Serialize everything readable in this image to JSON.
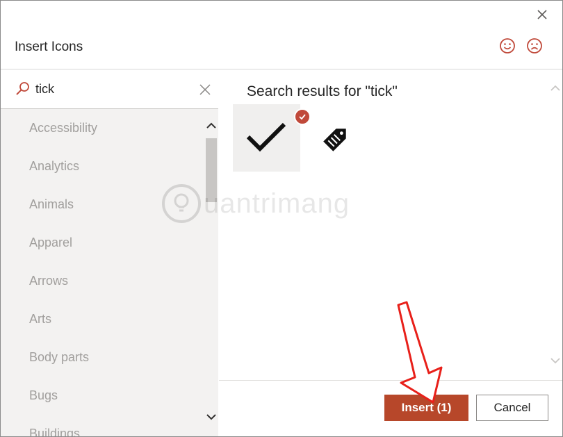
{
  "dialog": {
    "title": "Insert Icons",
    "close_icon": "close-icon",
    "feedback": {
      "happy_icon": "smiley-happy-icon",
      "sad_icon": "smiley-sad-icon"
    }
  },
  "search": {
    "value": "tick",
    "icon": "search-icon",
    "clear_icon": "close-icon"
  },
  "categories": [
    "Accessibility",
    "Analytics",
    "Animals",
    "Apparel",
    "Arrows",
    "Arts",
    "Body parts",
    "Bugs",
    "Buildings"
  ],
  "results": {
    "title": "Search results for \"tick\"",
    "items": [
      {
        "icon": "checkmark-icon",
        "selected": true
      },
      {
        "icon": "price-tag-icon",
        "selected": false
      }
    ]
  },
  "buttons": {
    "insert": "Insert (1)",
    "cancel": "Cancel"
  },
  "colors": {
    "accent": "#b7472a",
    "badge": "#c0493a",
    "pane_bg": "#f3f2f1"
  },
  "watermark": "uantrimang"
}
